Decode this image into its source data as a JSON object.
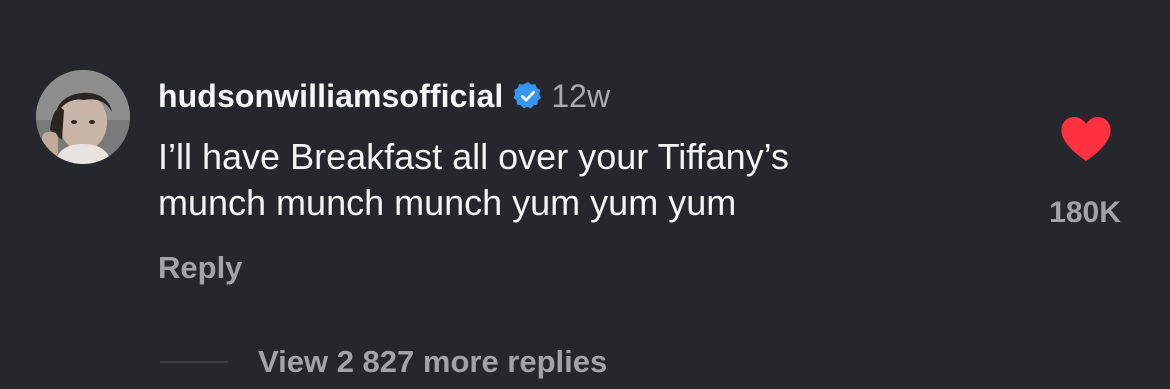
{
  "comment": {
    "username": "hudsonwilliamsofficial",
    "verified_icon": "verified-badge-icon",
    "timestamp": "12w",
    "text_lines": [
      "I’ll have Breakfast all over your Tiffany’s",
      "munch munch munch yum yum yum"
    ],
    "reply_label": "Reply",
    "like_icon": "heart-icon",
    "like_count": "180K",
    "like_color": "#ff3040",
    "view_more_label": "View 2 827 more replies"
  },
  "colors": {
    "background": "#25272c",
    "primary_text": "#f5f5f5",
    "secondary_text": "#a0a3a8",
    "verified_blue": "#3797f0"
  }
}
